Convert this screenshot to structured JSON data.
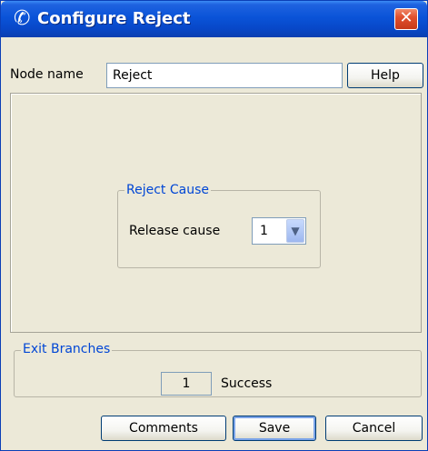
{
  "window": {
    "title": "Configure Reject",
    "close_glyph": "✕",
    "title_icon": "handset-icon"
  },
  "node": {
    "label": "Node name",
    "value": "Reject",
    "help_label": "Help"
  },
  "reject_cause": {
    "legend": "Reject Cause",
    "release_label": "Release cause",
    "release_value": "1"
  },
  "exit_branches": {
    "legend": "Exit Branches",
    "number": "1",
    "label": "Success"
  },
  "buttons": {
    "comments": "Comments",
    "save": "Save",
    "cancel": "Cancel"
  }
}
